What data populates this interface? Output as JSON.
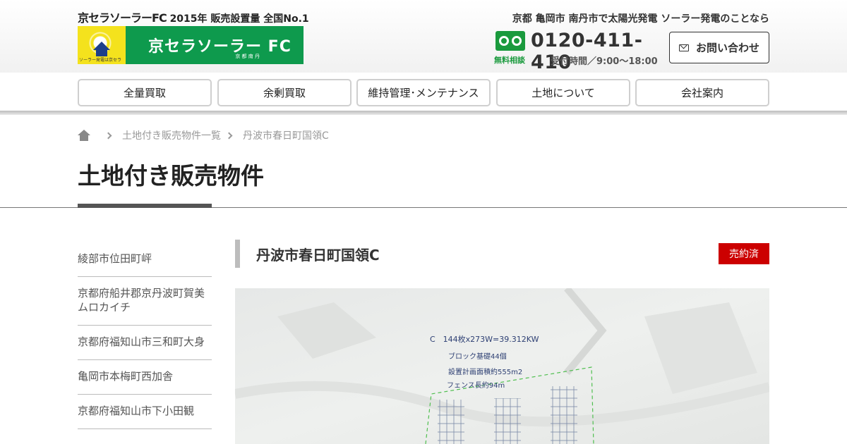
{
  "header": {
    "logo_brand": "京セラソーラー",
    "logo_fc": "FC",
    "logo_badge": "2015年 販売設置量 全国No.1",
    "banner_title": "京セラソーラー FC",
    "banner_subtitle": "京 都 南 丹",
    "banner_caption": "ソーラー発電は京セラ",
    "tagline": "京都 亀岡市 南丹市で太陽光発電 ソーラー発電のことなら",
    "phone": "0120-411-410",
    "free_label": "無料相談",
    "hours": "受付時間／9:00～18:00",
    "contact_label": "お問い合わせ"
  },
  "nav": {
    "items": [
      "全量買取",
      "余剰買取",
      "維持管理･メンテナンス",
      "土地について",
      "会社案内"
    ]
  },
  "breadcrumb": {
    "items": [
      "土地付き販売物件一覧",
      "丹波市春日町国領C"
    ]
  },
  "page_title": "土地付き販売物件",
  "sidebar": {
    "items": [
      "綾部市位田町岼",
      "京都府船井郡京丹波町賀美ムロカイチ",
      "京都府福知山市三和町大身",
      "亀岡市本梅町西加舎",
      "京都府福知山市下小田観"
    ]
  },
  "main": {
    "heading": "丹波市春日町国領C",
    "status": "売約済",
    "plan": {
      "line1": "C　144枚x273W=39.312KW",
      "line2": "ブロック基礎44個",
      "line3": "設置計画面積約555m2",
      "line4": "フェンス長約94m"
    }
  },
  "colors": {
    "brand_green": "#0e9a4d",
    "freedial_green": "#1a9a3d",
    "sold_red": "#cc0000"
  }
}
